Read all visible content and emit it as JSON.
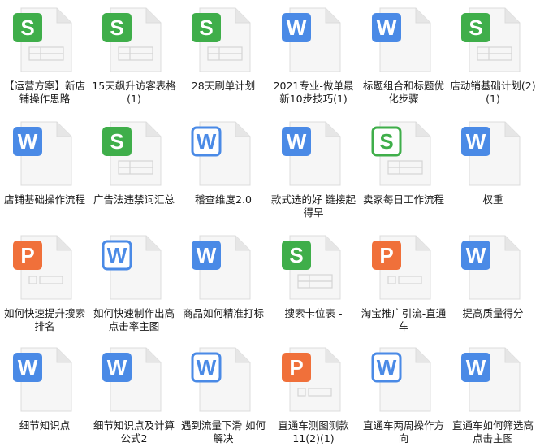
{
  "colors": {
    "spreadsheet": "#3fae4a",
    "word": "#4a8ae6",
    "presentation": "#f0703a",
    "page_fill": "#f6f6f6",
    "page_edge": "#dcdcdc"
  },
  "files": [
    {
      "label": "【运营方案】新店铺操作思路",
      "type": "spreadsheet",
      "icon": "spreadsheet-file-icon",
      "outline": false
    },
    {
      "label": "15天飙升访客表格(1)",
      "type": "spreadsheet",
      "icon": "spreadsheet-file-icon",
      "outline": false
    },
    {
      "label": "28天刷单计划",
      "type": "spreadsheet",
      "icon": "spreadsheet-file-icon",
      "outline": false
    },
    {
      "label": "2021专业-做单最新10步技巧(1)",
      "type": "word",
      "icon": "word-document-icon",
      "outline": false
    },
    {
      "label": "标题组合和标题优化步骤",
      "type": "word",
      "icon": "word-document-icon",
      "outline": false
    },
    {
      "label": "店动销基础计划(2)(1)",
      "type": "spreadsheet",
      "icon": "spreadsheet-file-icon",
      "outline": false
    },
    {
      "label": "店铺基础操作流程",
      "type": "word",
      "icon": "word-document-icon",
      "outline": false
    },
    {
      "label": "广告法违禁词汇总",
      "type": "spreadsheet",
      "icon": "spreadsheet-file-icon",
      "outline": false
    },
    {
      "label": "稽查维度2.0",
      "type": "word",
      "icon": "word-document-icon",
      "outline": true
    },
    {
      "label": "款式选的好 链接起得早",
      "type": "word",
      "icon": "word-document-icon",
      "outline": false
    },
    {
      "label": "卖家每日工作流程",
      "type": "spreadsheet",
      "icon": "spreadsheet-file-icon",
      "outline": true
    },
    {
      "label": "权重",
      "type": "word",
      "icon": "word-document-icon",
      "outline": false
    },
    {
      "label": "如何快速提升搜索排名",
      "type": "presentation",
      "icon": "presentation-file-icon",
      "outline": false
    },
    {
      "label": "如何快速制作出高点击率主图",
      "type": "word",
      "icon": "word-document-icon",
      "outline": true
    },
    {
      "label": "商品如何精准打标",
      "type": "word",
      "icon": "word-document-icon",
      "outline": false
    },
    {
      "label": "搜索卡位表 -",
      "type": "spreadsheet",
      "icon": "spreadsheet-file-icon",
      "outline": false
    },
    {
      "label": "淘宝推广引流-直通车",
      "type": "presentation",
      "icon": "presentation-file-icon",
      "outline": false
    },
    {
      "label": "提高质量得分",
      "type": "word",
      "icon": "word-document-icon",
      "outline": false
    },
    {
      "label": "细节知识点",
      "type": "word",
      "icon": "word-document-icon",
      "outline": false
    },
    {
      "label": "细节知识点及计算公式2",
      "type": "word",
      "icon": "word-document-icon",
      "outline": false
    },
    {
      "label": "遇到流量下滑 如何解决",
      "type": "word",
      "icon": "word-document-icon",
      "outline": true
    },
    {
      "label": "直通车测图测款11(2)(1)",
      "type": "presentation",
      "icon": "presentation-file-icon",
      "outline": false
    },
    {
      "label": "直通车两周操作方向",
      "type": "word",
      "icon": "word-document-icon",
      "outline": true
    },
    {
      "label": "直通车如何筛选高点击主图",
      "type": "word",
      "icon": "word-document-icon",
      "outline": false
    }
  ]
}
